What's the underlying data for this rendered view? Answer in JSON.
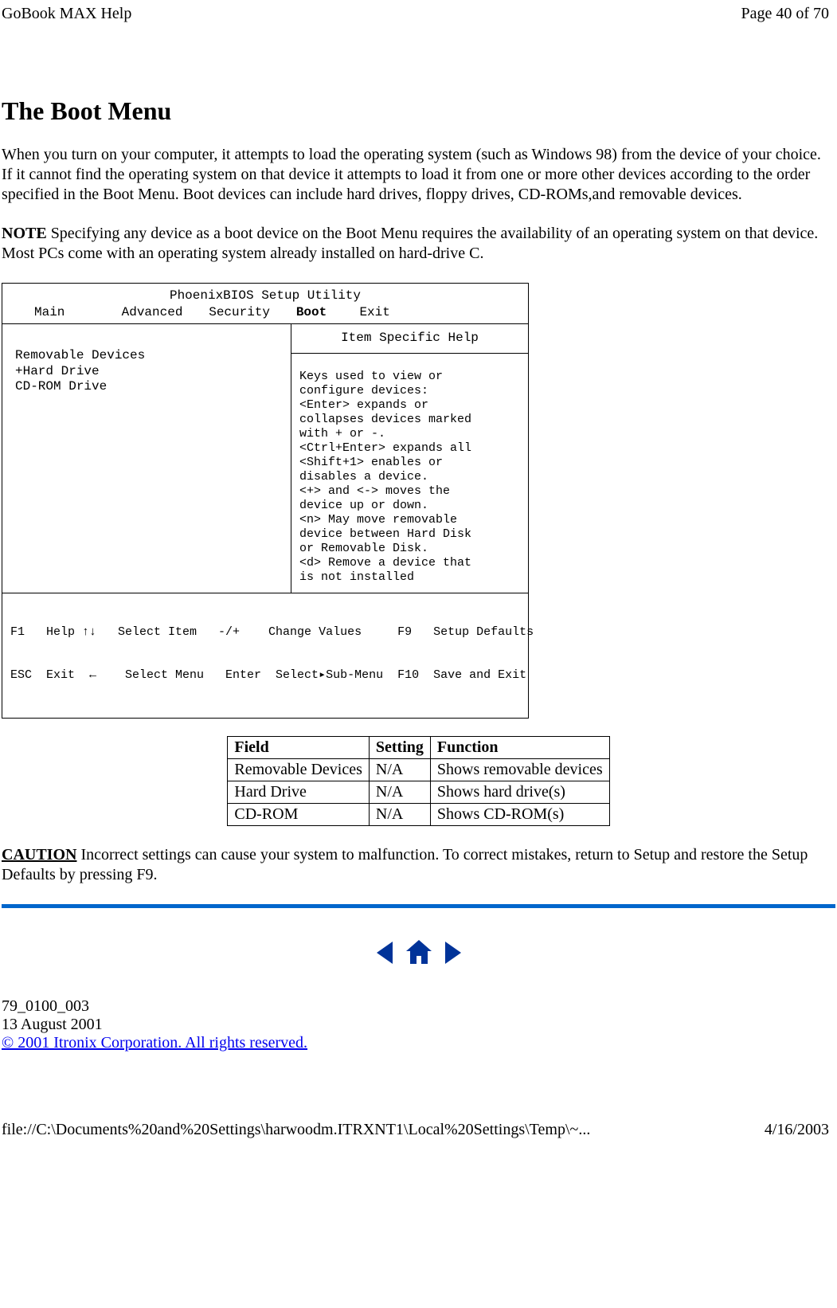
{
  "header": {
    "left": "GoBook MAX Help",
    "right": "Page 40 of 70"
  },
  "title": "The Boot Menu",
  "para1": "When you turn on your computer, it attempts to load the operating system (such as Windows 98) from the device of your choice.  If it cannot find the operating system on that device it attempts to load it from one or more other devices according to the order specified in the Boot Menu.  Boot devices can include hard drives, floppy drives, CD-ROMs,and  removable devices.",
  "note_label": "NOTE",
  "note_text": "  Specifying any device as a boot device on the Boot Menu requires the availability of an operating system on that device.  Most PCs come with an operating system already installed on hard-drive C.",
  "bios": {
    "title": "PhoenixBIOS Setup Utility",
    "menu": {
      "main": "Main",
      "advanced": "Advanced",
      "security": "Security",
      "boot": "Boot",
      "exit": "Exit"
    },
    "left_items": [
      "Removable Devices",
      "+Hard Drive",
      "CD-ROM Drive"
    ],
    "right_header": "Item Specific Help",
    "right_body": "Keys used to view or\nconfigure devices:\n<Enter> expands or\ncollapses devices marked\nwith + or -.\n<Ctrl+Enter> expands all\n<Shift+1> enables or\ndisables a device.\n<+> and <-> moves the\ndevice up or down.\n<n> May move removable\ndevice between Hard Disk\nor Removable Disk.\n<d> Remove a device that\nis not installed",
    "footer1": "F1   Help ↑↓   Select Item   -/+    Change Values     F9   Setup Defaults",
    "footer2": "ESC  Exit  ←    Select Menu   Enter  Select▸Sub-Menu  F10  Save and Exit"
  },
  "table": {
    "head": {
      "field": "Field",
      "setting": "Setting",
      "function": "Function"
    },
    "rows": [
      {
        "field": "Removable Devices",
        "setting": "N/A",
        "function": "Shows removable devices"
      },
      {
        "field": "Hard Drive",
        "setting": "N/A",
        "function": "Shows hard drive(s)"
      },
      {
        "field": "CD-ROM",
        "setting": "N/A",
        "function": "Shows CD-ROM(s)"
      }
    ]
  },
  "caution_label": "CAUTION",
  "caution_text": "  Incorrect settings can cause your system to malfunction.  To correct mistakes, return to Setup and restore the Setup Defaults by pressing F9.",
  "meta": {
    "doc_id": "79_0100_003",
    "date": "13 August 2001",
    "copyright": "© 2001 Itronix Corporation.  All rights reserved."
  },
  "footer": {
    "left": "file://C:\\Documents%20and%20Settings\\harwoodm.ITRXNT1\\Local%20Settings\\Temp\\~...",
    "right": "4/16/2003"
  }
}
